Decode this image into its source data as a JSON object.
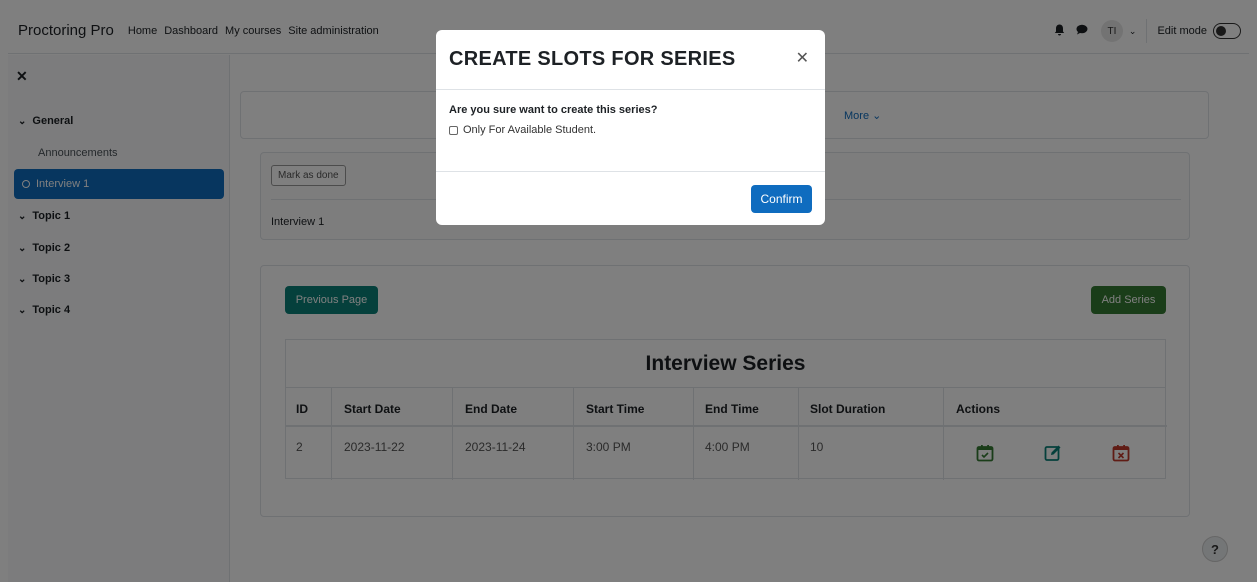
{
  "navbar": {
    "brand": "Proctoring Pro",
    "links": [
      "Home",
      "Dashboard",
      "My courses",
      "Site administration"
    ],
    "avatar_initials": "TI",
    "edit_mode_label": "Edit mode"
  },
  "sidebar": {
    "items": [
      {
        "label": "General"
      },
      {
        "label": "Announcements"
      },
      {
        "label": "Interview 1"
      },
      {
        "label": "Topic 1"
      },
      {
        "label": "Topic 2"
      },
      {
        "label": "Topic 3"
      },
      {
        "label": "Topic 4"
      }
    ]
  },
  "main": {
    "more_label": "More",
    "mark_done_label": "Mark as done",
    "activity_title": "Interview 1",
    "previous_page_label": "Previous Page",
    "add_series_label": "Add Series",
    "series_title": "Interview Series",
    "columns": [
      "ID",
      "Start Date",
      "End Date",
      "Start Time",
      "End Time",
      "Slot Duration",
      "Actions"
    ],
    "rows": [
      {
        "id": "2",
        "start_date": "2023-11-22",
        "end_date": "2023-11-24",
        "start_time": "3:00 PM",
        "end_time": "4:00 PM",
        "slot_duration": "10"
      }
    ],
    "help_label": "?"
  },
  "modal": {
    "title": "CREATE SLOTS FOR SERIES",
    "question": "Are you sure want to create this series?",
    "checkbox_label": "Only For Available Student.",
    "confirm_label": "Confirm"
  },
  "colors": {
    "primary": "#0f6cbf",
    "teal": "#0a8078",
    "green": "#357a32",
    "red": "#c0392b"
  }
}
